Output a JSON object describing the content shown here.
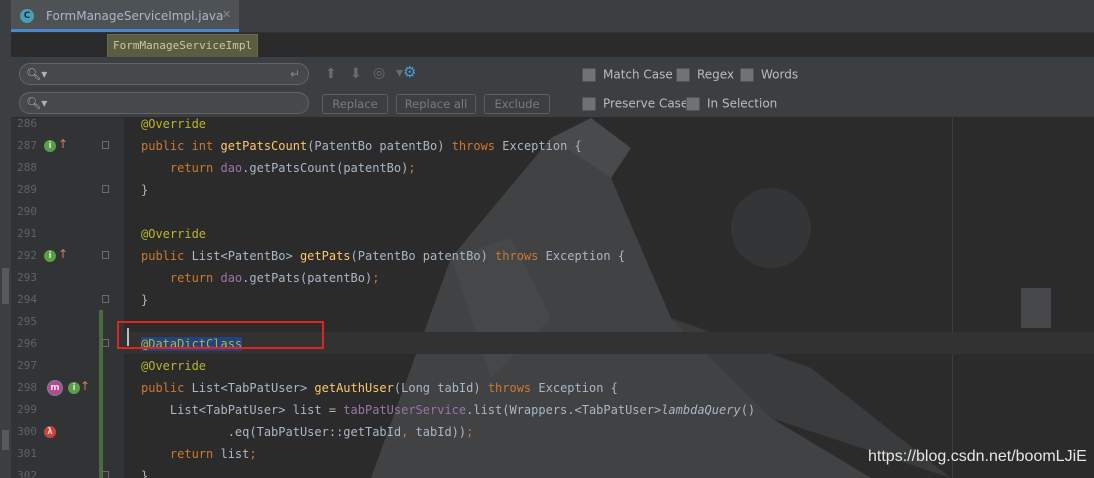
{
  "tab": {
    "title": "FormManageServiceImpl.java",
    "icon": "C",
    "close": "✕"
  },
  "tooltip": "FormManageServiceImpl",
  "find": {
    "search_value": "",
    "replace_value": "",
    "buttons": {
      "replace": "Replace",
      "replace_all": "Replace all",
      "exclude": "Exclude"
    },
    "options": {
      "match_case": "Match Case",
      "regex": "Regex",
      "words": "Words",
      "preserve_case": "Preserve Case",
      "in_selection": "In Selection"
    }
  },
  "editor": {
    "lines": [
      {
        "num": "286"
      },
      {
        "num": "287"
      },
      {
        "num": "288"
      },
      {
        "num": "289"
      },
      {
        "num": "290"
      },
      {
        "num": "291"
      },
      {
        "num": "292"
      },
      {
        "num": "293"
      },
      {
        "num": "294"
      },
      {
        "num": "295"
      },
      {
        "num": "296"
      },
      {
        "num": "297"
      },
      {
        "num": "298"
      },
      {
        "num": "299"
      },
      {
        "num": "300"
      },
      {
        "num": "301"
      },
      {
        "num": "302"
      }
    ]
  },
  "watermark": "https://blog.csdn.net/boomLJiE",
  "colors": {
    "keyword": "#cc7832",
    "annotation": "#bbb529",
    "method": "#ffc66d",
    "field": "#9876aa",
    "highlight_box": "#e02424"
  }
}
